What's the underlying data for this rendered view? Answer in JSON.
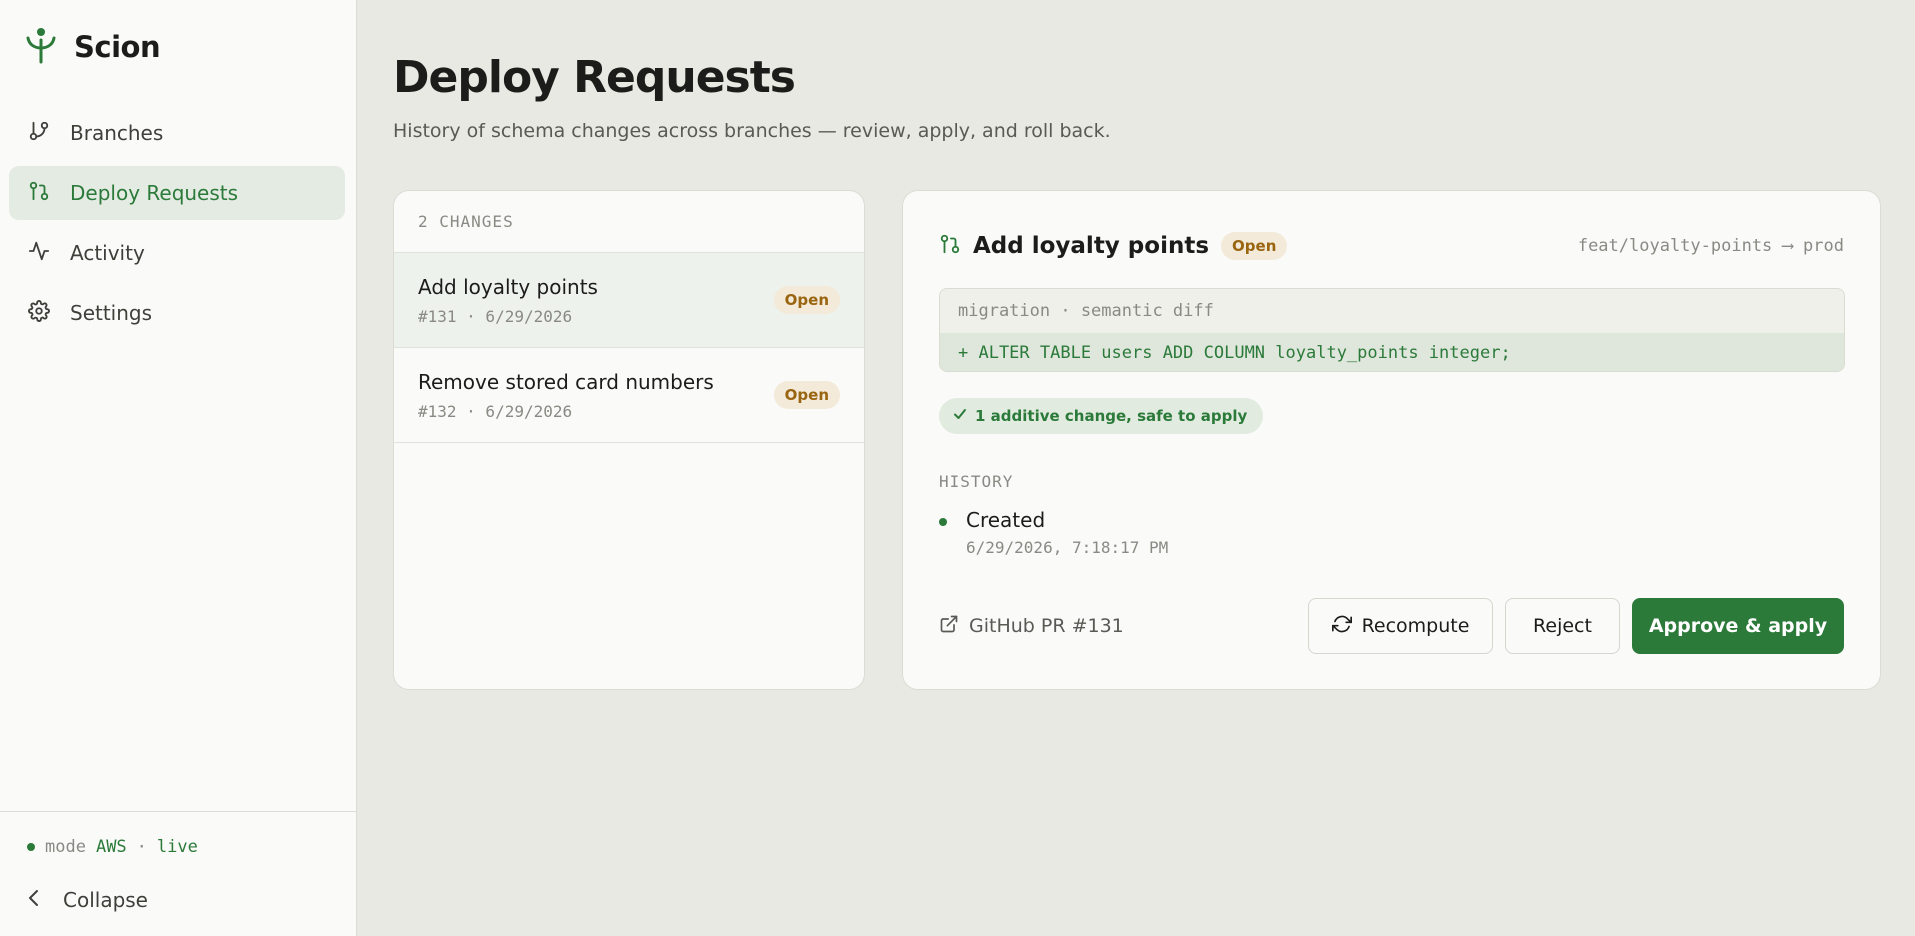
{
  "brand": {
    "name": "Scion",
    "logo_icon": "sprout-icon",
    "accent": "#2b7a3a"
  },
  "nav": {
    "items": [
      {
        "label": "Branches",
        "icon": "git-branch-icon",
        "active": false
      },
      {
        "label": "Deploy Requests",
        "icon": "git-pull-request-icon",
        "active": true
      },
      {
        "label": "Activity",
        "icon": "activity-icon",
        "active": false
      },
      {
        "label": "Settings",
        "icon": "gear-icon",
        "active": false
      }
    ]
  },
  "sidebar_footer": {
    "mode_label": "mode",
    "mode_value": "AWS",
    "separator": "·",
    "status": "live",
    "collapse_label": "Collapse"
  },
  "page": {
    "title": "Deploy Requests",
    "subtitle": "History of schema changes across branches — review, apply, and roll back."
  },
  "changes": {
    "header": "2 CHANGES",
    "items": [
      {
        "title": "Add loyalty points",
        "meta": "#131 · 6/29/2026",
        "status": "Open",
        "selected": true
      },
      {
        "title": "Remove stored card numbers",
        "meta": "#132 · 6/29/2026",
        "status": "Open",
        "selected": false
      }
    ]
  },
  "detail": {
    "title": "Add loyalty points",
    "status": "Open",
    "source_branch": "feat/loyalty-points",
    "arrow": "⟶",
    "target_branch": "prod",
    "diff_label": "migration · semantic diff",
    "diff_line": "+ ALTER TABLE users ADD COLUMN loyalty_points integer;",
    "safety": "1 additive change, safe to apply",
    "history_label": "HISTORY",
    "history": [
      {
        "event": "Created",
        "time": "6/29/2026, 7:18:17 PM"
      }
    ],
    "github_link": "GitHub PR #131",
    "buttons": {
      "recompute": "Recompute",
      "reject": "Reject",
      "approve": "Approve & apply"
    }
  },
  "colors": {
    "badge_bg": "#f3ead9",
    "badge_text": "#9a6510",
    "diff_add_bg": "#dfe7dc",
    "page_bg": "#e9e9e3"
  }
}
